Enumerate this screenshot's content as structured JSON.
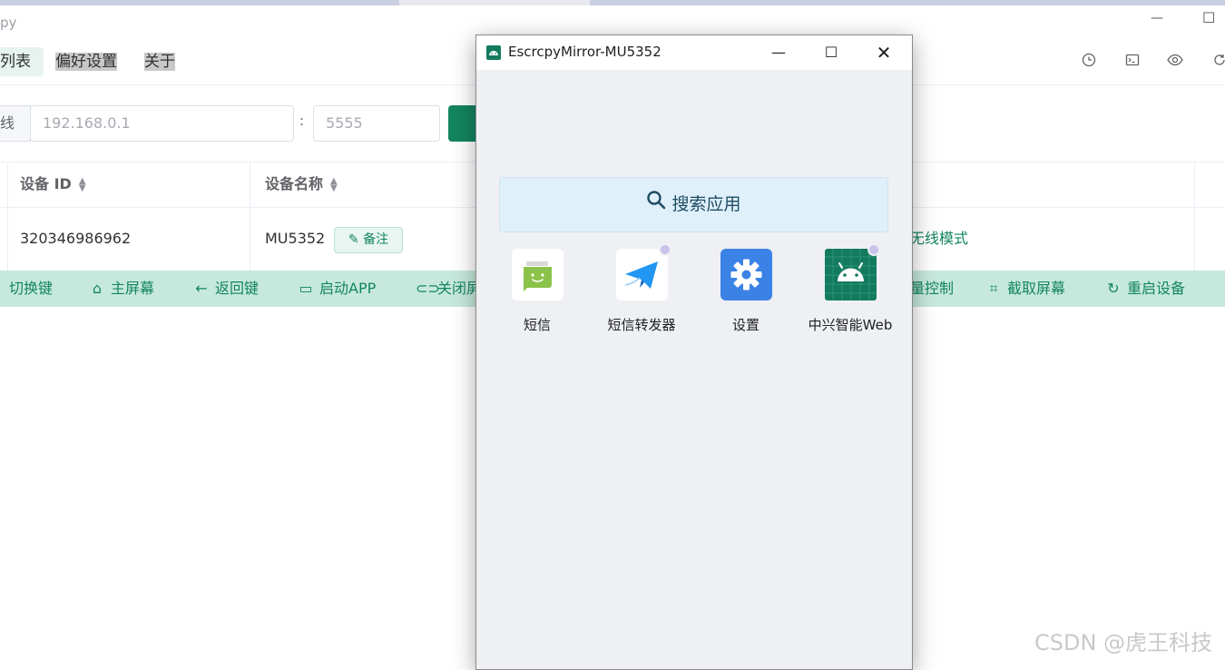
{
  "main_window": {
    "title_fragment": "py",
    "window_buttons": {
      "minimize": "—",
      "maximize": "☐"
    },
    "menu": [
      {
        "label": "列表"
      },
      {
        "label": "偏好设置"
      },
      {
        "label": "关于"
      }
    ],
    "toolbar_icons": [
      "clock-icon",
      "terminal-icon",
      "eye-icon",
      "refresh-icon"
    ],
    "connect": {
      "prefix": "线",
      "host_placeholder": "192.168.0.1",
      "separator": ":",
      "port_placeholder": "5555"
    },
    "table": {
      "headers": [
        "设备 ID",
        "设备名称"
      ],
      "rows": [
        {
          "device_id": "320346986962",
          "device_name": "MU5352",
          "note_label": "备注",
          "mode": "无线模式"
        }
      ]
    },
    "actions": [
      {
        "label": "切换键",
        "icon": "switch-icon"
      },
      {
        "label": "主屏幕",
        "icon": "home-icon"
      },
      {
        "label": "返回键",
        "icon": "arrow-left-icon"
      },
      {
        "label": "启动APP",
        "icon": "app-icon"
      },
      {
        "label": "关闭屏",
        "icon": "toggle-icon"
      },
      {
        "label": "量控制",
        "icon": "volume-icon"
      },
      {
        "label": "截取屏幕",
        "icon": "crop-icon"
      },
      {
        "label": "重启设备",
        "icon": "restart-icon"
      }
    ],
    "watermark": "CSDN @虎王科技"
  },
  "mirror_window": {
    "title": "EscrcpyMirror-MU5352",
    "search_label": "搜索应用",
    "apps": [
      {
        "label": "短信",
        "icon": "sms-app-icon",
        "color": "#8bc34a"
      },
      {
        "label": "短信转发器",
        "icon": "paper-plane-icon",
        "color": "#2196f3"
      },
      {
        "label": "设置",
        "icon": "settings-gear-icon",
        "color": "#3b82e6"
      },
      {
        "label": "中兴智能Web",
        "icon": "android-icon",
        "color": "#147a5e"
      }
    ]
  }
}
